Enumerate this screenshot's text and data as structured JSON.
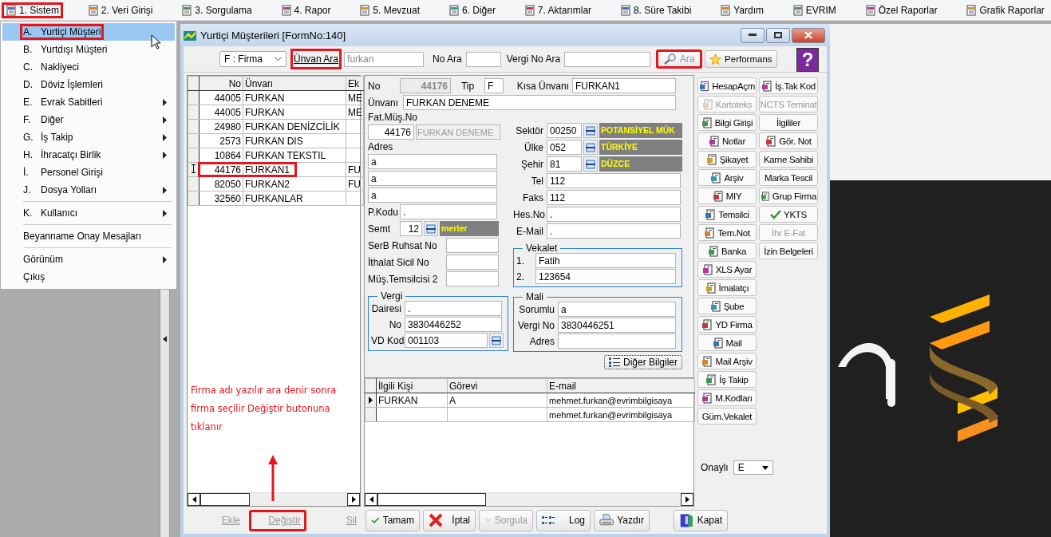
{
  "menubar": {
    "items": [
      {
        "label": "1. Sistem",
        "annotated": true
      },
      {
        "label": "2. Veri Girişi",
        "annotated": false
      },
      {
        "label": "3. Sorgulama",
        "annotated": false
      },
      {
        "label": "4. Rapor",
        "annotated": false
      },
      {
        "label": "5. Mevzuat",
        "annotated": false
      },
      {
        "label": "6. Diğer",
        "annotated": false
      },
      {
        "label": "7. Aktarımlar",
        "annotated": false
      },
      {
        "label": "8. Süre Takibi",
        "annotated": false
      },
      {
        "label": "Yardım",
        "annotated": false
      },
      {
        "label": "EVRIM",
        "annotated": false
      },
      {
        "label": "Özel Raporlar",
        "annotated": false
      },
      {
        "label": "Grafik Raporlar",
        "annotated": false
      }
    ]
  },
  "menu": {
    "groups": [
      [
        {
          "letter": "A.",
          "label": "Yurtiçi Müşteri",
          "submenu": false,
          "selected": true,
          "annotated": true
        },
        {
          "letter": "B.",
          "label": "Yurtdışı Müşteri",
          "submenu": false,
          "selected": false,
          "annotated": false
        },
        {
          "letter": "C.",
          "label": "Nakliyeci",
          "submenu": false,
          "selected": false,
          "annotated": false
        },
        {
          "letter": "D.",
          "label": "Döviz İşlemleri",
          "submenu": false,
          "selected": false,
          "annotated": false
        },
        {
          "letter": "E.",
          "label": "Evrak Sabitleri",
          "submenu": true,
          "selected": false,
          "annotated": false
        },
        {
          "letter": "F.",
          "label": "Diğer",
          "submenu": true,
          "selected": false,
          "annotated": false
        },
        {
          "letter": "G.",
          "label": "İş Takip",
          "submenu": true,
          "selected": false,
          "annotated": false
        },
        {
          "letter": "H.",
          "label": "İhracatçı Birlik",
          "submenu": true,
          "selected": false,
          "annotated": false
        },
        {
          "letter": "İ.",
          "label": "Personel Girişi",
          "submenu": false,
          "selected": false,
          "annotated": false
        },
        {
          "letter": "J.",
          "label": "Dosya Yolları",
          "submenu": true,
          "selected": false,
          "annotated": false
        }
      ],
      [
        {
          "letter": "K.",
          "label": "Kullanıcı",
          "submenu": true,
          "selected": false,
          "annotated": false
        }
      ],
      [
        {
          "label": "Beyanname Onay Mesajları",
          "submenu": false,
          "selected": false,
          "annotated": false
        }
      ],
      [
        {
          "label": "Görünüm",
          "submenu": true,
          "selected": false,
          "annotated": false
        },
        {
          "label": "Çıkış",
          "submenu": false,
          "selected": false,
          "annotated": false
        }
      ]
    ]
  },
  "window": {
    "title": "Yurtiçi Müşterileri [FormNo:140]"
  },
  "toolbar": {
    "type_select": "F : Firma",
    "title_search": {
      "label": "Ünvan Ara",
      "annotated": true
    },
    "title_value": "furkan",
    "no_label": "No Ara",
    "tax_no_label": "Vergi No Ara",
    "search_button": {
      "label": "Ara",
      "annotated": true,
      "disabled": true
    },
    "performance_button": "Performans",
    "help": "?"
  },
  "list": {
    "columns": [
      "No",
      "Ünvan",
      "Ek"
    ],
    "rows": [
      {
        "no": "44005",
        "name": "FURKAN",
        "ek": "ME",
        "current": false,
        "annotated": false
      },
      {
        "no": "44005",
        "name": "FURKAN",
        "ek": "ME",
        "current": false,
        "annotated": false
      },
      {
        "no": "24980",
        "name": "FURKAN DENİZCİLİK",
        "current": false,
        "annotated": false
      },
      {
        "no": "2573",
        "name": "FURKAN DIS",
        "current": false,
        "annotated": false
      },
      {
        "no": "10864",
        "name": "FURKAN TEKSTIL",
        "current": false,
        "annotated": false
      },
      {
        "no": "44176",
        "name": "FURKAN1",
        "ek": "FU",
        "current": true,
        "annotated": true
      },
      {
        "no": "82050",
        "name": "FURKAN2",
        "ek": "FU",
        "current": false,
        "annotated": false
      },
      {
        "no": "32560",
        "name": "FURKANLAR",
        "current": false,
        "annotated": false
      }
    ]
  },
  "annotation": "Firma adı yazılır ara denir sonra firma seçilir Değiştir butonuna tıklanır",
  "form": {
    "no": {
      "label": "No",
      "value": "44176"
    },
    "tip": {
      "label": "Tip",
      "value": "F"
    },
    "short_title": {
      "label": "Kısa Ünvanı",
      "value": "FURKAN1"
    },
    "title": {
      "label": "Ünvanı",
      "value": "FURKAN DENEME"
    },
    "invoice_customer": {
      "label": "Fat.Müş.No",
      "no": "44176",
      "name": "FURKAN DENEME"
    },
    "address": {
      "label": "Adres",
      "lines": [
        "a",
        "a",
        "a"
      ]
    },
    "postal_code": {
      "label": "P.Kodu",
      "value": "."
    },
    "district": {
      "label": "Semt",
      "code": "12",
      "name": "merter"
    },
    "left_fields": [
      {
        "label": "SerB Ruhsat No"
      },
      {
        "label": "İthalat Sicil No"
      },
      {
        "label": "Müş.Temsilcisi 2"
      }
    ],
    "tax": {
      "title": "Vergi",
      "fields": [
        {
          "label": "Dairesi",
          "value": ".",
          "lookup": false
        },
        {
          "label": "No",
          "value": "3830446252",
          "lookup": false
        },
        {
          "label": "VD Kod",
          "value": "001103",
          "lookup": true
        }
      ]
    },
    "lookups": [
      {
        "label": "Sektör",
        "code": "00250",
        "name": "POTANSİYEL MÜK"
      },
      {
        "label": "Ülke",
        "code": "052",
        "name": "TÜRKİYE"
      },
      {
        "label": "Şehir",
        "code": "81",
        "name": "DÜZCE"
      }
    ],
    "contact_fields": [
      {
        "label": "Tel",
        "value": "112"
      },
      {
        "label": "Faks",
        "value": "112"
      },
      {
        "label": "Hes.No",
        "value": "."
      },
      {
        "label": "E-Mail",
        "value": "."
      }
    ],
    "proxy": {
      "title": "Vekalet",
      "lines": [
        {
          "label": "1.",
          "value": "Fatih"
        },
        {
          "label": "2.",
          "value": "123654"
        }
      ]
    },
    "finance": {
      "title": "Mali",
      "fields": [
        {
          "label": "Sorumlu",
          "value": "a"
        },
        {
          "label": "Vergi No",
          "value": "3830446251"
        },
        {
          "label": "Adres"
        }
      ]
    },
    "more_button": "Diğer Bilgiler"
  },
  "contacts": {
    "columns": [
      "İlgili Kişi",
      "Görevi",
      "E-mail"
    ],
    "rows": [
      {
        "person": "FURKAN",
        "role": "A",
        "email": "mehmet.furkan@evrimbilgisaya",
        "current": true
      },
      {
        "email": "mehmet.furkan@evrimbilgisaya",
        "current": false
      }
    ]
  },
  "side_buttons": {
    "left": [
      {
        "label": "HesapAçm",
        "kind": "icon",
        "disabled": false
      },
      {
        "label": "Kartoteks",
        "kind": "icon",
        "disabled": true
      },
      {
        "label": "Bilgi Girişi",
        "kind": "icon",
        "disabled": false
      },
      {
        "label": "Notlar",
        "kind": "icon",
        "disabled": false
      },
      {
        "label": "Şikayet",
        "kind": "icon",
        "disabled": false
      },
      {
        "label": "Arşiv",
        "kind": "icon",
        "disabled": false
      },
      {
        "label": "MIY",
        "kind": "icon",
        "disabled": false
      },
      {
        "label": "Temsilci",
        "kind": "icon",
        "disabled": false
      },
      {
        "label": "Tem.Not",
        "kind": "icon",
        "disabled": false
      },
      {
        "label": "Banka",
        "kind": "icon",
        "disabled": false
      },
      {
        "label": "XLS Ayar",
        "kind": "icon",
        "disabled": false
      },
      {
        "label": "İmalatçı",
        "kind": "icon",
        "disabled": false
      },
      {
        "label": "Şube",
        "kind": "icon",
        "disabled": false
      },
      {
        "label": "YD Firma",
        "kind": "icon",
        "disabled": false
      },
      {
        "label": "Mail",
        "kind": "icon",
        "disabled": false
      },
      {
        "label": "Mail Arşiv",
        "kind": "icon",
        "disabled": false
      },
      {
        "label": "İş Takip",
        "kind": "icon",
        "disabled": false
      },
      {
        "label": "M.Kodları",
        "kind": "icon",
        "disabled": false
      },
      {
        "label": "Güm.Vekalet",
        "kind": "plain",
        "disabled": false
      }
    ],
    "right": [
      {
        "label": "İş.Tak Kod",
        "kind": "icon",
        "disabled": false
      },
      {
        "label": "NCTS Teminat",
        "kind": "plain",
        "disabled": true
      },
      {
        "label": "İlgililer",
        "kind": "plain",
        "disabled": false
      },
      {
        "label": "Gör. Not",
        "kind": "icon",
        "disabled": false
      },
      {
        "label": "Karne Sahibi",
        "kind": "plain",
        "disabled": false
      },
      {
        "label": "Marka Tescil",
        "kind": "plain",
        "disabled": false
      },
      {
        "label": "Grup Firma",
        "kind": "icon",
        "disabled": false
      },
      {
        "label": "YKTS",
        "kind": "check",
        "disabled": false
      },
      {
        "label": "İhr E-Fat",
        "kind": "plain",
        "disabled": true
      },
      {
        "label": "İzin Belgeleri",
        "kind": "plain",
        "disabled": false
      }
    ]
  },
  "approval": {
    "label": "Onaylı",
    "value": "E"
  },
  "bottom_buttons": [
    {
      "label": "Ekle",
      "kind": "plain",
      "disabled": true,
      "annotated": false
    },
    {
      "label": "Değiştir",
      "kind": "plain",
      "disabled": true,
      "annotated": true
    },
    {
      "label": "Sil",
      "kind": "plain",
      "disabled": true,
      "annotated": false
    },
    {
      "label": "Tamam",
      "kind": "check",
      "disabled": false,
      "annotated": false
    },
    {
      "label": "İptal",
      "kind": "cross",
      "disabled": false,
      "annotated": false
    },
    {
      "label": "Sorgula",
      "kind": "query",
      "disabled": true,
      "annotated": false
    },
    {
      "label": "Log",
      "kind": "list",
      "disabled": false,
      "annotated": false
    },
    {
      "label": "Yazdır",
      "kind": "printer",
      "disabled": false,
      "annotated": false
    },
    {
      "label": "Kapat",
      "kind": "door",
      "disabled": false,
      "annotated": false
    }
  ]
}
